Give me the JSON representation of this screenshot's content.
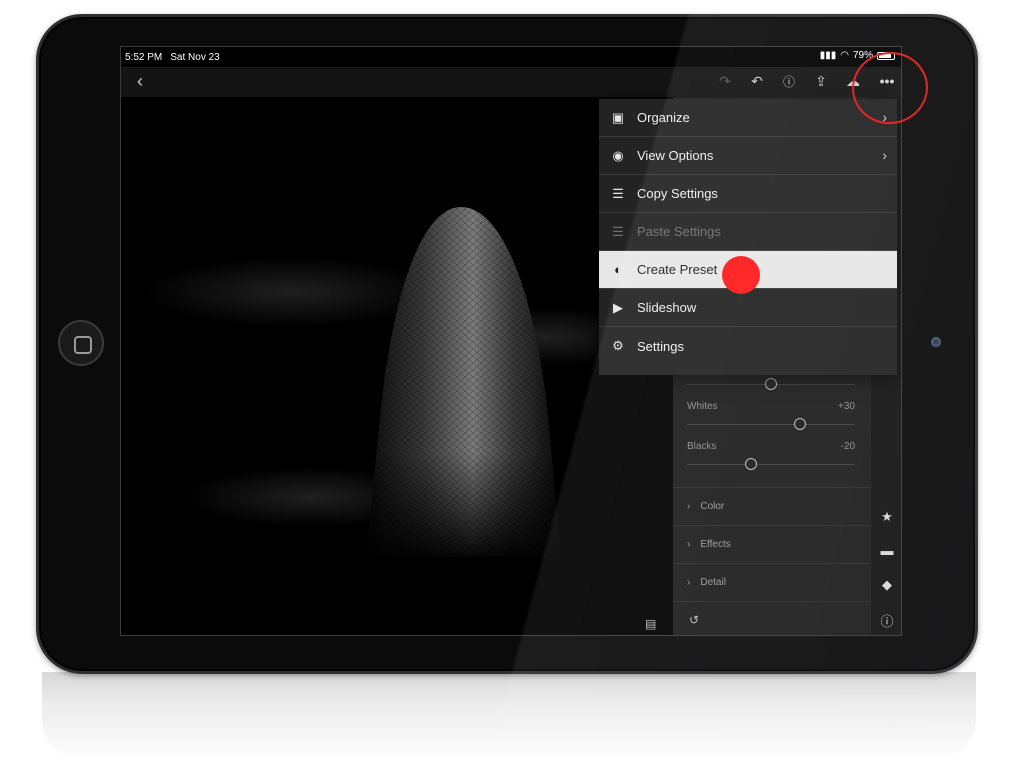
{
  "status_bar": {
    "time": "5:52 PM",
    "date": "Sat Nov 23",
    "battery": "79%"
  },
  "toolbar": {
    "back_icon": "chevron-left-icon",
    "icons": [
      "redo-icon",
      "undo-icon",
      "help-icon",
      "share-icon",
      "cloud-add-icon",
      "more-icon"
    ]
  },
  "menu": {
    "items": [
      {
        "label": "Organize",
        "icon": "organize-icon",
        "has_submenu": true,
        "disabled": false,
        "highlighted": false
      },
      {
        "label": "View Options",
        "icon": "view-options-icon",
        "has_submenu": true,
        "disabled": false,
        "highlighted": false
      },
      {
        "label": "Copy Settings",
        "icon": "copy-settings-icon",
        "has_submenu": false,
        "disabled": false,
        "highlighted": false
      },
      {
        "label": "Paste Settings",
        "icon": "paste-settings-icon",
        "has_submenu": false,
        "disabled": true,
        "highlighted": false
      },
      {
        "label": "Create Preset",
        "icon": "create-preset-icon",
        "has_submenu": false,
        "disabled": false,
        "highlighted": true
      },
      {
        "label": "Slideshow",
        "icon": "play-icon",
        "has_submenu": false,
        "disabled": false,
        "highlighted": false
      },
      {
        "label": "Settings",
        "icon": "gear-icon",
        "has_submenu": false,
        "disabled": false,
        "highlighted": false
      }
    ]
  },
  "edit_panel": {
    "sliders": [
      {
        "label": "Whites",
        "value": "+30",
        "level": 0.65
      },
      {
        "label": "Blacks",
        "value": "-20",
        "level": 0.4
      }
    ],
    "sections": [
      "Color",
      "Effects",
      "Detail"
    ]
  },
  "side_rail": {
    "icons": [
      "star-icon",
      "comment-icon",
      "tag-icon",
      "info-icon"
    ]
  },
  "colors": {
    "highlight": "#e7e7e7",
    "annotation_red": "#ff1a1a",
    "menu_bg": "#232323",
    "panel_bg": "#1e1e1e"
  }
}
